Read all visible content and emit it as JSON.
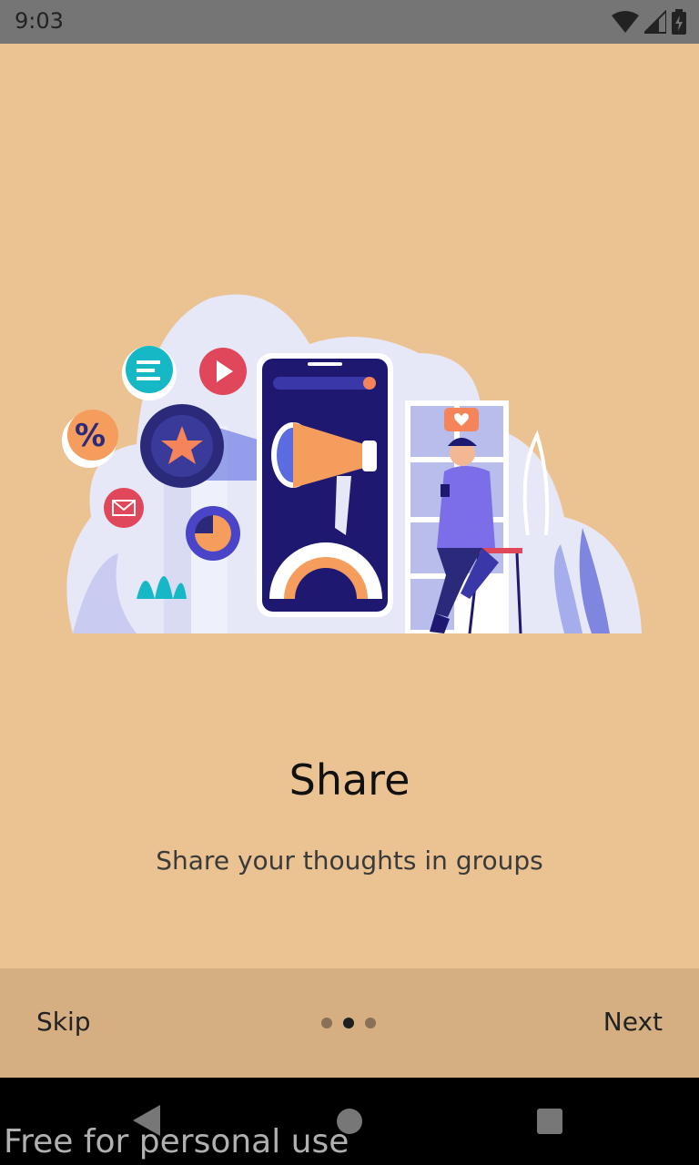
{
  "status_bar": {
    "time": "9:03"
  },
  "onboarding": {
    "title": "Share",
    "subtitle": "Share your thoughts in groups"
  },
  "pager": {
    "total": 3,
    "active_index": 1
  },
  "footer": {
    "skip_label": "Skip",
    "next_label": "Next"
  },
  "watermark": "Free for personal use",
  "colors": {
    "background": "#EBC393",
    "footer": "#D5AE82",
    "status": "#757575",
    "nav": "#000000"
  }
}
